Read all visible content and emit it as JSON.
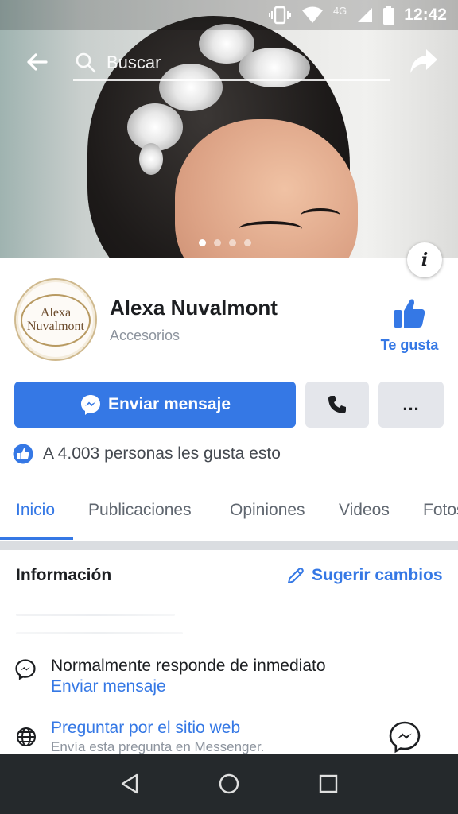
{
  "status_bar": {
    "time": "12:42",
    "network": "4G"
  },
  "top_nav": {
    "search_placeholder": "Buscar"
  },
  "cover": {
    "slide_count": 4,
    "active_slide": 1
  },
  "profile": {
    "logo_line1": "Alexa",
    "logo_line2": "Nuvalmont",
    "name": "Alexa Nuvalmont",
    "category": "Accesorios",
    "like_label": "Te gusta"
  },
  "actions": {
    "message_label": "Enviar mensaje",
    "more_label": "..."
  },
  "likes_text": "A 4.003 personas les gusta esto",
  "tabs": [
    {
      "label": "Inicio",
      "active": true
    },
    {
      "label": "Publicaciones",
      "active": false
    },
    {
      "label": "Opiniones",
      "active": false
    },
    {
      "label": "Videos",
      "active": false
    },
    {
      "label": "Fotos",
      "active": false
    }
  ],
  "info": {
    "title": "Información",
    "suggest_label": "Sugerir cambios",
    "response_text": "Normalmente responde de inmediato",
    "response_link": "Enviar mensaje",
    "website_question": "Preguntar por el sitio web",
    "website_sub": "Envía esta pregunta en Messenger."
  },
  "colors": {
    "accent": "#3578e5",
    "text": "#1c1e21",
    "muted": "#8d949e",
    "button_gray": "#e4e6eb"
  },
  "icons": {
    "back": "back-arrow-icon",
    "search": "search-icon",
    "share": "share-icon",
    "info": "info-icon",
    "like": "thumbs-up-icon",
    "messenger": "messenger-icon",
    "phone": "phone-icon",
    "globe": "globe-icon",
    "pencil": "pencil-icon"
  }
}
